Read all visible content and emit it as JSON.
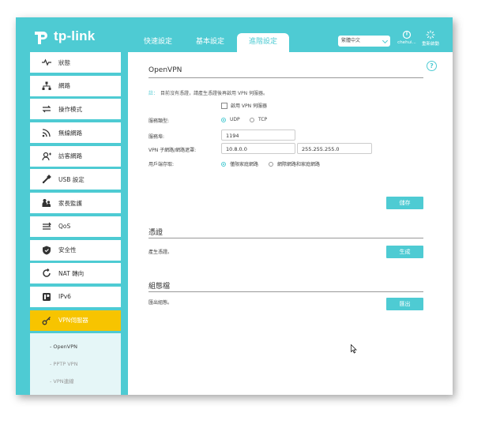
{
  "brand": {
    "name": "tp-link"
  },
  "top_tabs": [
    {
      "label": "快速設定",
      "active": false
    },
    {
      "label": "基本設定",
      "active": false
    },
    {
      "label": "進階設定",
      "active": true
    }
  ],
  "language": {
    "selected": "繁體中文"
  },
  "header_buttons": {
    "logout": "chehui...",
    "reboot": "重新啟動"
  },
  "sidebar": {
    "items": [
      {
        "label": "狀態",
        "icon": "pulse-icon"
      },
      {
        "label": "網路",
        "icon": "network-icon"
      },
      {
        "label": "操作模式",
        "icon": "mode-switch-icon"
      },
      {
        "label": "無線網路",
        "icon": "wifi-icon"
      },
      {
        "label": "訪客網路",
        "icon": "guest-icon"
      },
      {
        "label": "USB 設定",
        "icon": "usb-icon"
      },
      {
        "label": "家長監護",
        "icon": "family-icon"
      },
      {
        "label": "QoS",
        "icon": "qos-icon"
      },
      {
        "label": "安全性",
        "icon": "shield-icon"
      },
      {
        "label": "NAT 轉向",
        "icon": "nat-icon"
      },
      {
        "label": "IPv6",
        "icon": "ipv6-icon"
      },
      {
        "label": "VPN伺服器",
        "icon": "vpn-key-icon",
        "active": true
      }
    ],
    "submenu": [
      {
        "label": "- OpenVPN",
        "active": true
      },
      {
        "label": "- PPTP VPN",
        "active": false
      },
      {
        "label": "- VPN連線",
        "active": false
      }
    ]
  },
  "openvpn": {
    "title": "OpenVPN",
    "note_label": "註：",
    "note": "目前沒有憑證，請產生憑證後再啟用 VPN 伺服器。",
    "enable_label": "啟用 VPN 伺服器",
    "service_type_label": "服務類型:",
    "udp": "UDP",
    "tcp": "TCP",
    "port_label": "服務埠:",
    "port": "1194",
    "subnet_label": "VPN 子網路/網路遮罩:",
    "subnet": "10.8.0.0",
    "netmask": "255.255.255.0",
    "client_access_label": "用戶端存取:",
    "access_home": "僅限家庭網路",
    "access_internet": "網際網路和家庭網路",
    "save": "儲存"
  },
  "certificate": {
    "title": "憑證",
    "label": "產生憑證。",
    "button": "生成"
  },
  "config_file": {
    "title": "組態檔",
    "label": "匯出組態。",
    "button": "匯出"
  }
}
